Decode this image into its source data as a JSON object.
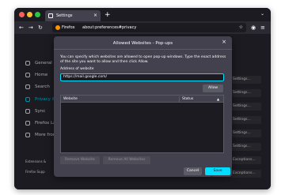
{
  "browser": {
    "tab_title": "Settings",
    "tab_close": "×",
    "new_tab": "+",
    "tabs_menu": "⌄",
    "url_brand": "Firefox",
    "url_text": "about:preferences#privacy"
  },
  "sidebar": {
    "items": [
      {
        "label": "General"
      },
      {
        "label": "Home"
      },
      {
        "label": "Search"
      },
      {
        "label": "Privacy &"
      },
      {
        "label": "Sync"
      },
      {
        "label": "Firefox Lab"
      },
      {
        "label": "More from"
      }
    ],
    "extensions_label": "Extensions &",
    "support_label": "Firefox Supp"
  },
  "main": {
    "settings_button_label": "Settings...",
    "exceptions_button_label": "Exceptions..."
  },
  "dialog": {
    "title": "Allowed Websites - Pop-ups",
    "description": "You can specify which websites are allowed to open pop-up windows. Type the exact address of the site you want to allow and then click Allow.",
    "address_label": "Address of website",
    "address_value": "https://mail.google.com/",
    "allow_label": "Allow",
    "column_website": "Website",
    "column_status": "Status",
    "remove_label": "Remove Website",
    "remove_all_label": "Remove All Websites",
    "cancel_label": "Cancel",
    "save_label": "Save Changes"
  },
  "colors": {
    "accent": "#00ddff",
    "dialog_bg": "#42414d",
    "page_bg": "#2b2a33"
  }
}
